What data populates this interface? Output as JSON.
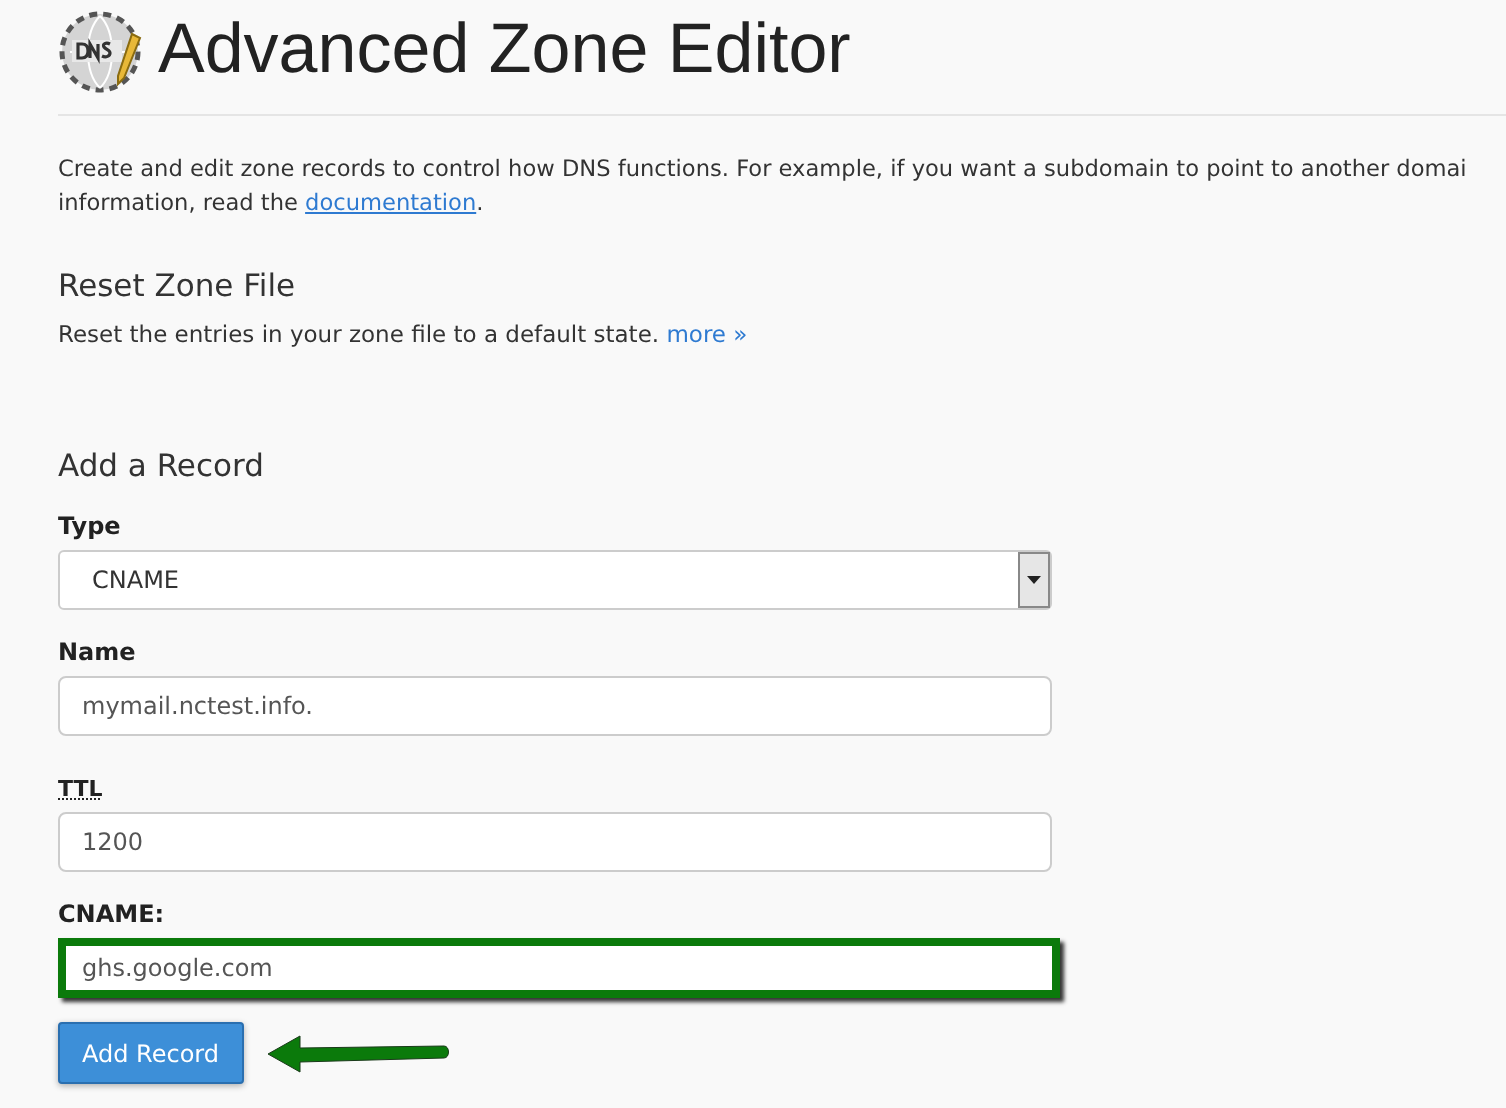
{
  "page": {
    "title": "Advanced Zone Editor"
  },
  "intro": {
    "text_before": "Create and edit zone records to control how DNS functions. For example, if you want a subdomain to point to another domai\ninformation, read the ",
    "link": "documentation",
    "text_after": "."
  },
  "reset": {
    "heading": "Reset Zone File",
    "text": "Reset the entries in your zone file to a default state.",
    "link": "more »"
  },
  "add_record": {
    "heading": "Add a Record",
    "fields": [
      {
        "kind": "select",
        "label": "Type",
        "value": "CNAME",
        "abbr": false,
        "highlighted": false
      },
      {
        "kind": "text",
        "label": "Name",
        "value": "mymail.nctest.info.",
        "abbr": false,
        "highlighted": false
      },
      {
        "kind": "text",
        "label": "TTL",
        "value": "1200",
        "abbr": true,
        "highlighted": false
      },
      {
        "kind": "text",
        "label": "CNAME:",
        "value": "ghs.google.com",
        "abbr": false,
        "highlighted": true
      }
    ],
    "button": "Add Record"
  }
}
